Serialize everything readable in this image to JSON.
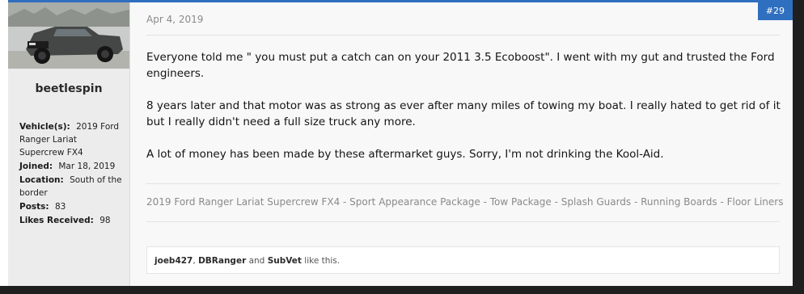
{
  "post": {
    "date": "Apr 4, 2019",
    "number": "#29",
    "paragraphs": [
      "Everyone told me \" you must put a catch can on your 2011 3.5 Ecoboost\". I went with my gut and trusted the Ford engineers.",
      "8 years later and that motor was as strong as ever after many miles of towing my boat. I really hated to get rid of it but I really didn't need a full size truck any more.",
      "A lot of money has been made by these aftermarket guys. Sorry, I'm not drinking the Kool-Aid."
    ],
    "signature": "2019 Ford Ranger Lariat Supercrew FX4 - Sport Appearance Package - Tow Package - Splash Guards - Running Boards - Floor Liners"
  },
  "user": {
    "name": "beetlespin",
    "fields": [
      {
        "label": "Vehicle(s):",
        "value": "2019 Ford Ranger Lariat Supercrew FX4"
      },
      {
        "label": "Joined:",
        "value": "Mar 18, 2019"
      },
      {
        "label": "Location:",
        "value": "South of the border"
      },
      {
        "label": "Posts:",
        "value": "83"
      },
      {
        "label": "Likes Received:",
        "value": "98"
      }
    ]
  },
  "likes": {
    "user1": "joeb427",
    "sep1": ", ",
    "user2": "DBRanger",
    "sep2": " and ",
    "user3": "SubVet",
    "suffix": " like this."
  },
  "colors": {
    "accent": "#2f6fbf",
    "muted": "#8a8a8a"
  }
}
